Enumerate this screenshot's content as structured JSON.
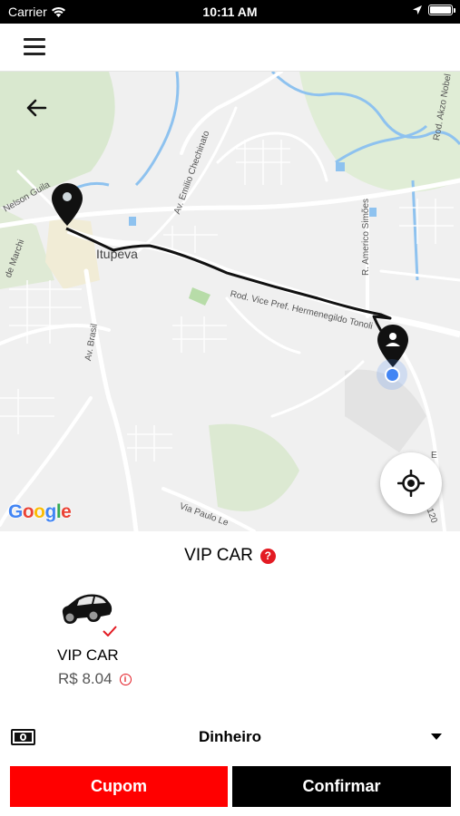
{
  "status_bar": {
    "carrier": "Carrier",
    "time": "10:11 AM"
  },
  "map": {
    "place_labels": {
      "city": "Itupeva",
      "road_main": "Rod. Vice Pref. Hermenegildo Tonoli",
      "road_brasil": "Av. Brasil",
      "road_emilio": "Av. Emilio Chechinato",
      "road_americo": "R. Americo Simões",
      "road_akzo": "Rod. Akzo Nobel",
      "road_nelson": "Nelson Guila",
      "road_marchi": "de Marchi",
      "road_paulo": "Via Paulo Le",
      "road_number": "120",
      "road_e": "E"
    },
    "attribution": "Google",
    "attribution_colors": [
      "#4285F4",
      "#EA4335",
      "#FBBC05",
      "#4285F4",
      "#34A853",
      "#EA4335"
    ]
  },
  "panel": {
    "title": "VIP CAR",
    "help_symbol": "?",
    "vehicle": {
      "name": "VIP CAR",
      "price": "R$ 8.04",
      "selected": true,
      "info_symbol": "i"
    },
    "payment": {
      "method": "Dinheiro"
    },
    "buttons": {
      "coupon": "Cupom",
      "confirm": "Confirmar"
    }
  },
  "colors": {
    "accent_red": "#ff0000",
    "help_red": "#e31b23",
    "confirm_black": "#000000",
    "location_blue": "#4285F4"
  },
  "icons": {
    "menu": "hamburger-icon",
    "back": "arrow-left-icon",
    "locate": "crosshair-icon",
    "pickup": "map-pin-icon",
    "destination": "map-pin-icon",
    "car": "car-icon",
    "check": "checkmark-icon",
    "cash": "banknote-icon",
    "caret": "chevron-down-icon"
  }
}
